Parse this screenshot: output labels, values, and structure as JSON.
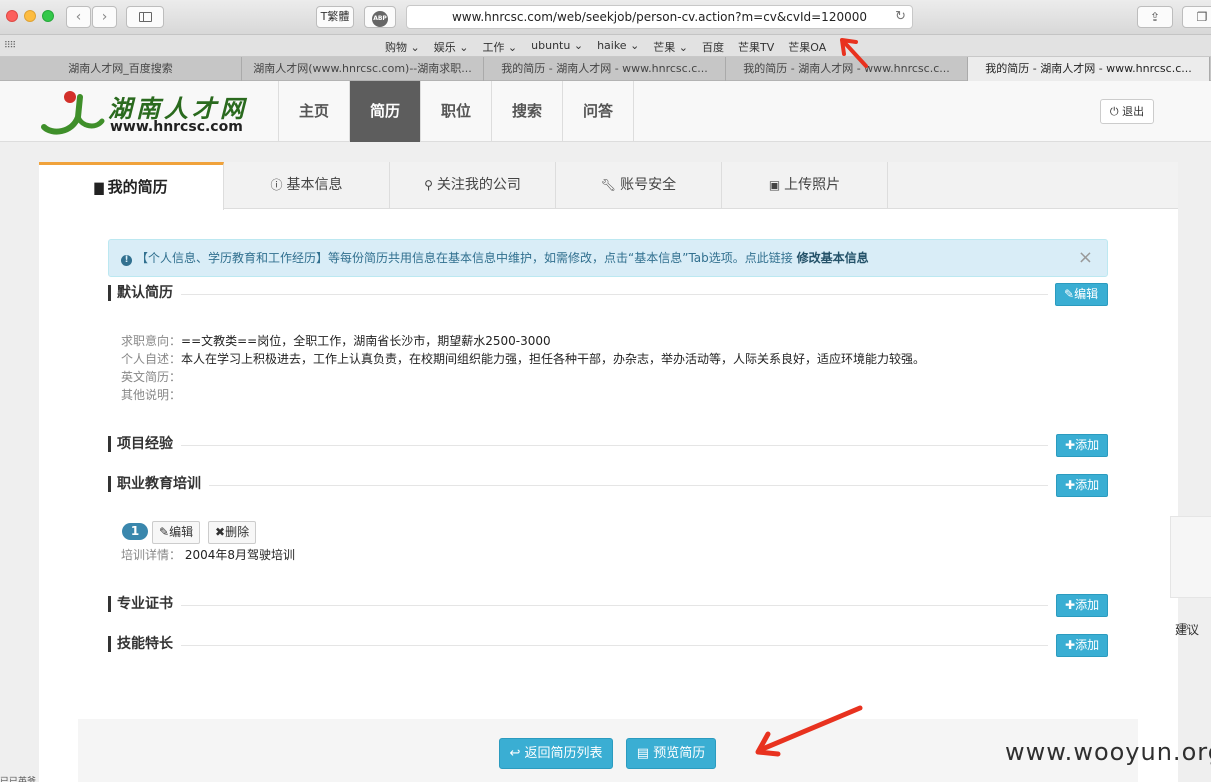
{
  "browser": {
    "url": "www.hnrcsc.com/web/seekjob/person-cv.action?m=cv&cvId=120000",
    "ext_label": "T繁體",
    "adblock_label": "ABP",
    "bookmarks": [
      "购物 ⌄",
      "娱乐 ⌄",
      "工作 ⌄",
      "ubuntu ⌄",
      "haike ⌄",
      "芒果 ⌄",
      "百度",
      "芒果TV",
      "芒果OA"
    ],
    "tabs": [
      "湖南人才网_百度搜索",
      "湖南人才网(www.hnrcsc.com)--湖南求职...",
      "我的简历 - 湖南人才网 - www.hnrcsc.c...",
      "我的简历 - 湖南人才网 - www.hnrcsc.c...",
      "我的简历 - 湖南人才网 - www.hnrcsc.c..."
    ]
  },
  "site": {
    "logo_text": "湖南人才网",
    "logo_url": "www.hnrcsc.com",
    "nav": [
      "主页",
      "简历",
      "职位",
      "搜索",
      "问答"
    ],
    "logout": "退出"
  },
  "content_tabs": [
    "我的简历",
    "基本信息",
    "关注我的公司",
    "账号安全",
    "上传照片"
  ],
  "alert": {
    "text": "【个人信息、学历教育和工作经历】等每份简历共用信息在基本信息中维护，如需修改，点击“基本信息”Tab选项。点此链接",
    "link": "修改基本信息",
    "close": "×"
  },
  "sections": {
    "default_cv": "默认简历",
    "projects": "项目经验",
    "training": "职业教育培训",
    "certificates": "专业证书",
    "skills": "技能特长"
  },
  "buttons": {
    "edit": "编辑",
    "add": "添加",
    "delete": "删除",
    "back": "返回简历列表",
    "preview": "预览简历"
  },
  "cv": {
    "intention_label": "求职意向：",
    "intention_value": "==文教类==岗位，全职工作，湖南省长沙市，期望薪水2500-3000",
    "self_label": "个人自述：",
    "self_value": "本人在学习上积极进去，工作上认真负责，在校期间组织能力强，担任各种干部，办杂志，举办活动等，人际关系良好，适应环境能力较强。",
    "english_label": "英文简历：",
    "other_label": "其他说明："
  },
  "training": {
    "index": "1",
    "detail_label": "培训详情：",
    "detail_value": "2004年8月驾驶培训"
  },
  "suggest": "建议",
  "watermark": "www.wooyun.org",
  "cutoff_text": "已已英爷"
}
